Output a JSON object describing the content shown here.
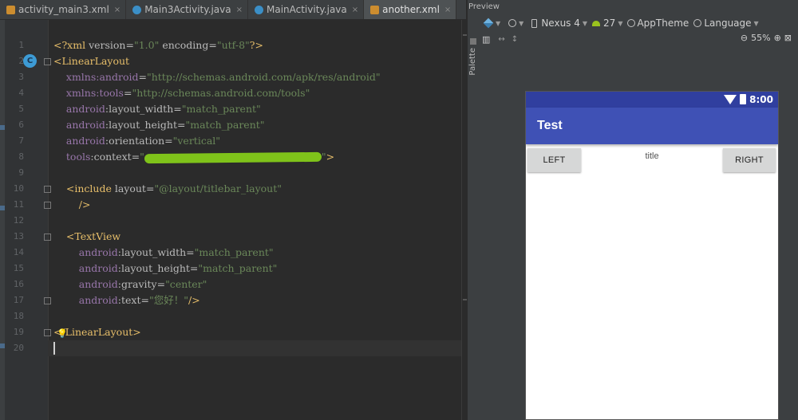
{
  "tabs": [
    {
      "label": "activity_main3.xml",
      "icon": "xml-file-icon",
      "active": false
    },
    {
      "label": "Main3Activity.java",
      "icon": "java-class-icon",
      "active": false
    },
    {
      "label": "MainActivity.java",
      "icon": "java-class-icon",
      "active": false
    },
    {
      "label": "another.xml",
      "icon": "xml-file-icon",
      "active": true
    }
  ],
  "tab_close": "×",
  "editor": {
    "line_numbers": [
      "1",
      "2",
      "3",
      "4",
      "5",
      "6",
      "7",
      "8",
      "9",
      "10",
      "11",
      "12",
      "13",
      "14",
      "15",
      "16",
      "17",
      "18",
      "19",
      "20"
    ],
    "badge": "C",
    "lines": [
      {
        "num": 1,
        "parts": [
          {
            "c": "pi",
            "t": "<?xml "
          },
          {
            "c": "attr",
            "t": "version="
          },
          {
            "c": "str",
            "t": "\"1.0\""
          },
          {
            "c": "attr",
            "t": " encoding="
          },
          {
            "c": "str",
            "t": "\"utf-8\""
          },
          {
            "c": "pi",
            "t": "?>"
          }
        ]
      },
      {
        "num": 2,
        "parts": [
          {
            "c": "t",
            "t": "<LinearLayout"
          }
        ]
      },
      {
        "num": 3,
        "parts": [
          {
            "c": "ns",
            "t": "    xmlns:"
          },
          {
            "c": "ns",
            "t": "android"
          },
          {
            "c": "attr",
            "t": "="
          },
          {
            "c": "str",
            "t": "\"http://schemas.android.com/apk/res/android\""
          }
        ]
      },
      {
        "num": 4,
        "parts": [
          {
            "c": "ns",
            "t": "    xmlns:"
          },
          {
            "c": "ns",
            "t": "tools"
          },
          {
            "c": "attr",
            "t": "="
          },
          {
            "c": "str",
            "t": "\"http://schemas.android.com/tools\""
          }
        ]
      },
      {
        "num": 5,
        "parts": [
          {
            "c": "ns",
            "t": "    android"
          },
          {
            "c": "attr",
            "t": ":layout_width="
          },
          {
            "c": "str",
            "t": "\"match_parent\""
          }
        ]
      },
      {
        "num": 6,
        "parts": [
          {
            "c": "ns",
            "t": "    android"
          },
          {
            "c": "attr",
            "t": ":layout_height="
          },
          {
            "c": "str",
            "t": "\"match_parent\""
          }
        ]
      },
      {
        "num": 7,
        "parts": [
          {
            "c": "ns",
            "t": "    android"
          },
          {
            "c": "attr",
            "t": ":orientation="
          },
          {
            "c": "str",
            "t": "\"vertical\""
          }
        ]
      },
      {
        "num": 8,
        "parts": [
          {
            "c": "ns",
            "t": "    tools"
          },
          {
            "c": "attr",
            "t": ":context="
          },
          {
            "c": "str",
            "t": "\""
          },
          {
            "c": "redact",
            "t": ""
          },
          {
            "c": "str",
            "t": "\""
          },
          {
            "c": "t",
            "t": ">"
          }
        ]
      },
      {
        "num": 9,
        "parts": []
      },
      {
        "num": 10,
        "parts": [
          {
            "c": "t",
            "t": "    <include "
          },
          {
            "c": "attr",
            "t": "layout="
          },
          {
            "c": "str",
            "t": "\"@layout/titlebar_layout\""
          }
        ]
      },
      {
        "num": 11,
        "parts": [
          {
            "c": "t",
            "t": "        />"
          }
        ]
      },
      {
        "num": 12,
        "parts": []
      },
      {
        "num": 13,
        "parts": [
          {
            "c": "t",
            "t": "    <TextView"
          }
        ]
      },
      {
        "num": 14,
        "parts": [
          {
            "c": "ns",
            "t": "        android"
          },
          {
            "c": "attr",
            "t": ":layout_width="
          },
          {
            "c": "str",
            "t": "\"match_parent\""
          }
        ]
      },
      {
        "num": 15,
        "parts": [
          {
            "c": "ns",
            "t": "        android"
          },
          {
            "c": "attr",
            "t": ":layout_height="
          },
          {
            "c": "str",
            "t": "\"match_parent\""
          }
        ]
      },
      {
        "num": 16,
        "parts": [
          {
            "c": "ns",
            "t": "        android"
          },
          {
            "c": "attr",
            "t": ":gravity="
          },
          {
            "c": "str",
            "t": "\"center\""
          }
        ]
      },
      {
        "num": 17,
        "parts": [
          {
            "c": "ns",
            "t": "        android"
          },
          {
            "c": "attr",
            "t": ":text="
          },
          {
            "c": "str",
            "t": "\"您好！\""
          },
          {
            "c": "t",
            "t": "/>"
          }
        ]
      },
      {
        "num": 18,
        "parts": []
      },
      {
        "num": 19,
        "parts": [
          {
            "c": "t",
            "t": "</LinearLayout>"
          }
        ]
      },
      {
        "num": 20,
        "parts": []
      }
    ]
  },
  "palette": {
    "label": "Palette"
  },
  "preview": {
    "title": "Preview",
    "device": "Nexus 4",
    "api": "27",
    "theme": "AppTheme",
    "language": "Language",
    "zoom": "55%"
  },
  "phone": {
    "time": "8:00",
    "app_title": "Test",
    "left_button": "LEFT",
    "center_title": "title",
    "right_button": "RIGHT",
    "colors": {
      "status_bar": "#303f9f",
      "action_bar": "#3f51b5",
      "button": "#d6d7d7"
    }
  }
}
